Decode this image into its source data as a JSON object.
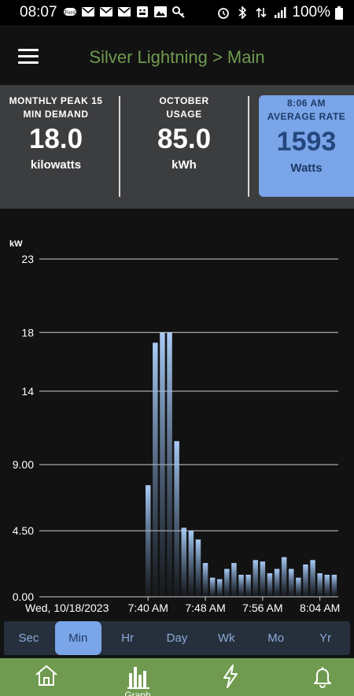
{
  "status_bar": {
    "time": "08:07",
    "left_icons": [
      "ford-icon",
      "mail-icon",
      "mail-icon",
      "mail-icon",
      "android-icon",
      "image-icon",
      "key-icon"
    ],
    "right_icons": [
      "alarm-icon",
      "bluetooth-icon",
      "data-icon",
      "signal-icon"
    ],
    "battery": "100%"
  },
  "app_bar": {
    "title": "Silver Lightning > Main"
  },
  "stats": {
    "peak": {
      "label_line1": "MONTHLY PEAK 15",
      "label_line2": "MIN DEMAND",
      "value": "18.0",
      "unit": "kilowatts"
    },
    "usage": {
      "label_line1": "OCTOBER",
      "label_line2": "USAGE",
      "value": "85.0",
      "unit": "kWh"
    },
    "rate": {
      "time": "8:06 AM",
      "label": "AVERAGE RATE",
      "value": "1593",
      "unit": "Watts"
    }
  },
  "range_tabs": {
    "selected": "Min",
    "items": [
      "Sec",
      "Min",
      "Hr",
      "Day",
      "Wk",
      "Mo",
      "Yr"
    ]
  },
  "bottom_nav": {
    "items": [
      {
        "icon": "home-icon"
      },
      {
        "icon": "bar-chart-icon",
        "label": "Graph"
      },
      {
        "icon": "lightning-icon"
      },
      {
        "icon": "bell-icon"
      }
    ]
  },
  "colors": {
    "accent_green": "#6f9a4f",
    "accent_blue": "#7aa5e8",
    "bar_color": "#9cc0ee"
  },
  "chart_data": {
    "type": "bar",
    "ylabel": "kW",
    "ylim": [
      0,
      23
    ],
    "y_ticks": [
      "0.00",
      "4.50",
      "9.00",
      "14",
      "18",
      "23"
    ],
    "y_tick_values": [
      0,
      4.5,
      9,
      14,
      18,
      23
    ],
    "x_first_label": "Wed, 10/18/2023",
    "x_labels": [
      "7:40 AM",
      "7:48 AM",
      "7:56 AM",
      "8:04 AM"
    ],
    "x_label_bar_index": [
      0,
      8,
      16,
      24
    ],
    "x": [
      "7:40 AM",
      "7:41 AM",
      "7:42 AM",
      "7:43 AM",
      "7:44 AM",
      "7:45 AM",
      "7:46 AM",
      "7:47 AM",
      "7:48 AM",
      "7:49 AM",
      "7:50 AM",
      "7:51 AM",
      "7:52 AM",
      "7:53 AM",
      "7:54 AM",
      "7:55 AM",
      "7:56 AM",
      "7:57 AM",
      "7:58 AM",
      "7:59 AM",
      "8:00 AM",
      "8:01 AM",
      "8:02 AM",
      "8:03 AM",
      "8:04 AM",
      "8:05 AM",
      "8:06 AM"
    ],
    "values": [
      7.6,
      17.3,
      18.0,
      18.0,
      10.6,
      4.7,
      4.5,
      3.9,
      2.3,
      1.3,
      1.2,
      1.9,
      2.3,
      1.5,
      1.5,
      2.5,
      2.4,
      1.6,
      1.9,
      2.7,
      1.9,
      1.3,
      2.2,
      2.5,
      1.6,
      1.5,
      1.5
    ],
    "grid": true
  }
}
